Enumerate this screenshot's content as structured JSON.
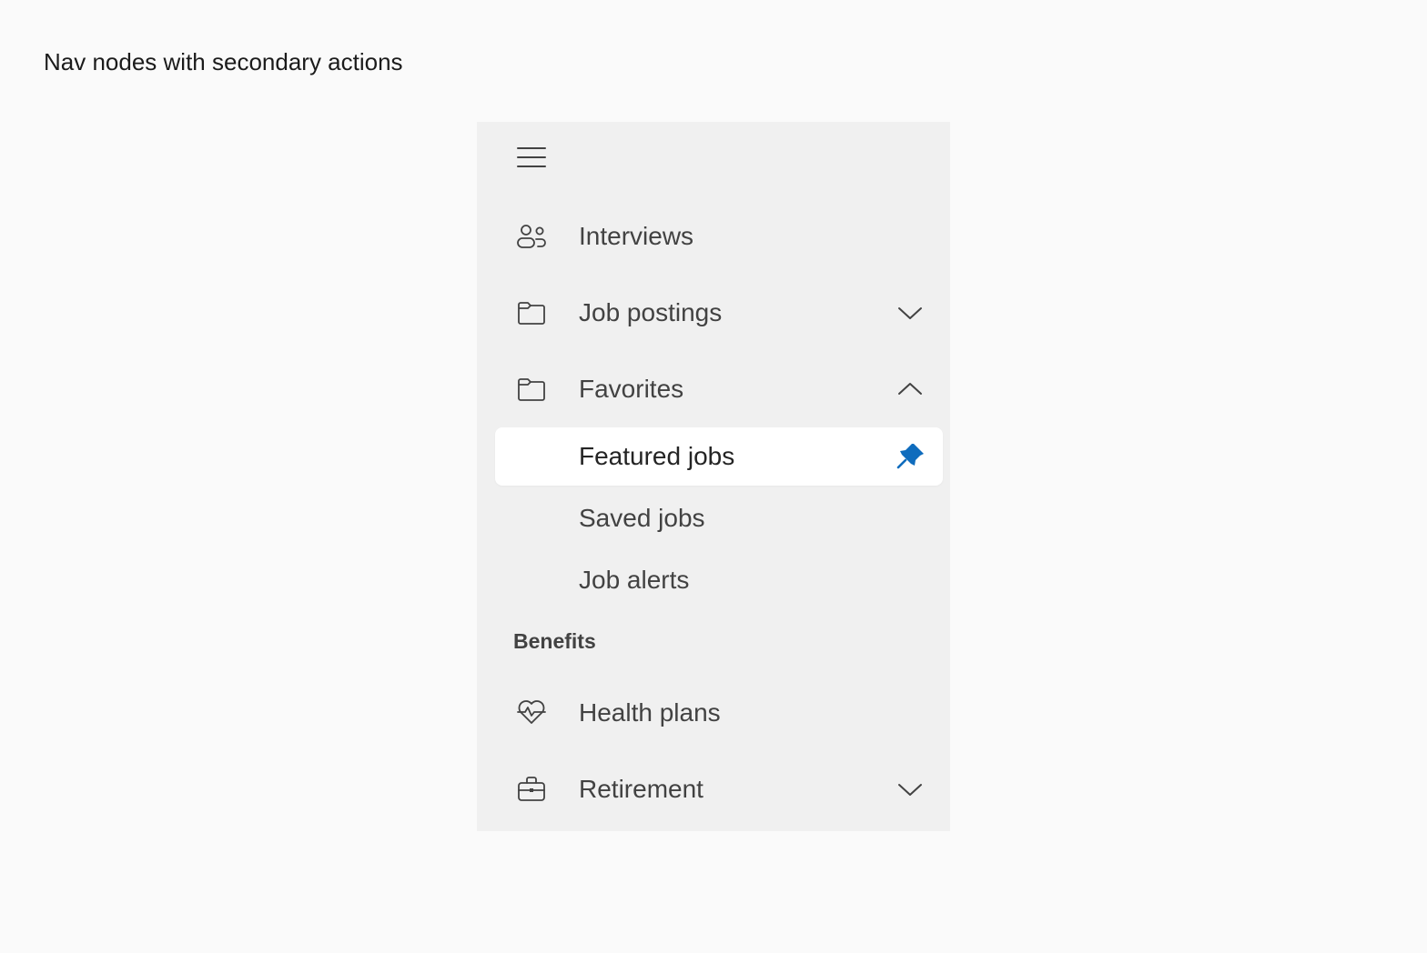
{
  "page": {
    "heading": "Nav nodes with secondary actions"
  },
  "nav": {
    "menu_icon": "hamburger-icon",
    "items": [
      {
        "label": "Interviews",
        "icon": "people-icon"
      },
      {
        "label": "Job postings",
        "icon": "folder-icon",
        "chevron": "chevron-down-icon",
        "expanded": false
      },
      {
        "label": "Favorites",
        "icon": "folder-icon",
        "chevron": "chevron-up-icon",
        "expanded": true,
        "children": [
          {
            "label": "Featured jobs",
            "selected": true,
            "action_icon": "pin-icon"
          },
          {
            "label": "Saved jobs"
          },
          {
            "label": "Job alerts"
          }
        ]
      }
    ],
    "sections": [
      {
        "header": "Benefits",
        "items": [
          {
            "label": "Health plans",
            "icon": "heart-pulse-icon"
          },
          {
            "label": "Retirement",
            "icon": "briefcase-icon",
            "chevron": "chevron-down-icon",
            "expanded": false
          }
        ]
      }
    ]
  },
  "colors": {
    "page_background": "#fafafa",
    "nav_background": "#f0f0f0",
    "selected_background": "#ffffff",
    "text": "#424242",
    "accent": "#0f6cbd"
  }
}
